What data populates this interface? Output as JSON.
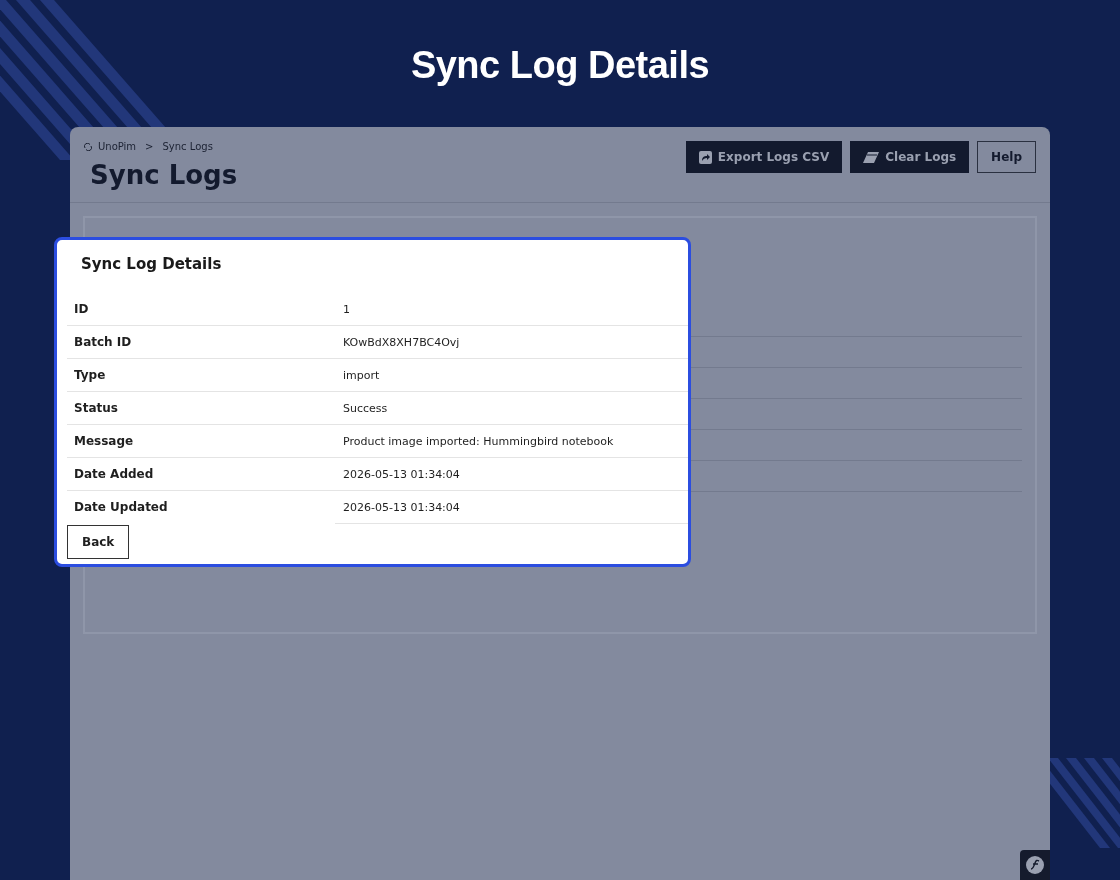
{
  "page_title": "Sync Log Details",
  "breadcrumb": {
    "items": [
      "UnoPim",
      "Sync Logs"
    ],
    "separator": ">"
  },
  "heading": "Sync Logs",
  "actions": [
    {
      "label": "Export Logs CSV",
      "kind": "export"
    },
    {
      "label": "Clear Logs",
      "kind": "clear"
    },
    {
      "label": "Help",
      "kind": "outline"
    }
  ],
  "modal": {
    "title": "Sync Log Details",
    "rows": [
      {
        "label": "ID",
        "value": "1"
      },
      {
        "label": "Batch ID",
        "value": "KOwBdX8XH7BC4Ovj"
      },
      {
        "label": "Type",
        "value": "import"
      },
      {
        "label": "Status",
        "value": "Success"
      },
      {
        "label": "Message",
        "value": "Product image imported: Hummingbird notebook"
      },
      {
        "label": "Date Added",
        "value": "2026-05-13 01:34:04"
      },
      {
        "label": "Date Updated",
        "value": "2026-05-13 01:34:04"
      }
    ],
    "back_button": "Back"
  }
}
